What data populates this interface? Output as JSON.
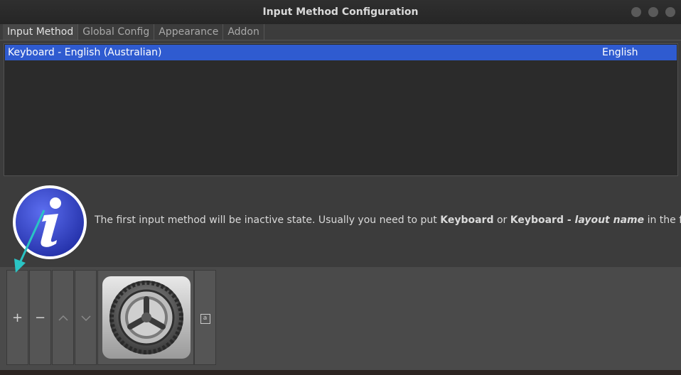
{
  "window": {
    "title": "Input Method Configuration"
  },
  "tabs": [
    {
      "label": "Input Method"
    },
    {
      "label": "Global Config"
    },
    {
      "label": "Appearance"
    },
    {
      "label": "Addon"
    }
  ],
  "input_methods": [
    {
      "name": "Keyboard - English (Australian)",
      "language": "English",
      "selected": true
    }
  ],
  "hint": {
    "text_before": "The first input method will be inactive state. Usually you need to put ",
    "bold_1": "Keyboard",
    "text_mid": " or ",
    "bold_2": "Keyboard - ",
    "bold_italic": "layout name",
    "text_after": " in the first place."
  },
  "toolbar": {
    "add_label": "+",
    "remove_label": "−",
    "up_label": "^",
    "down_label": "⌄",
    "keyboard_label": "a"
  },
  "colors": {
    "selection": "#2f5bd0",
    "annotation_arrow": "#2ac4c4",
    "info_icon": "#3a49c8"
  },
  "icons": {
    "info": "info-icon",
    "config": "gear-icon",
    "keyboard_layout": "keyboard-icon"
  }
}
